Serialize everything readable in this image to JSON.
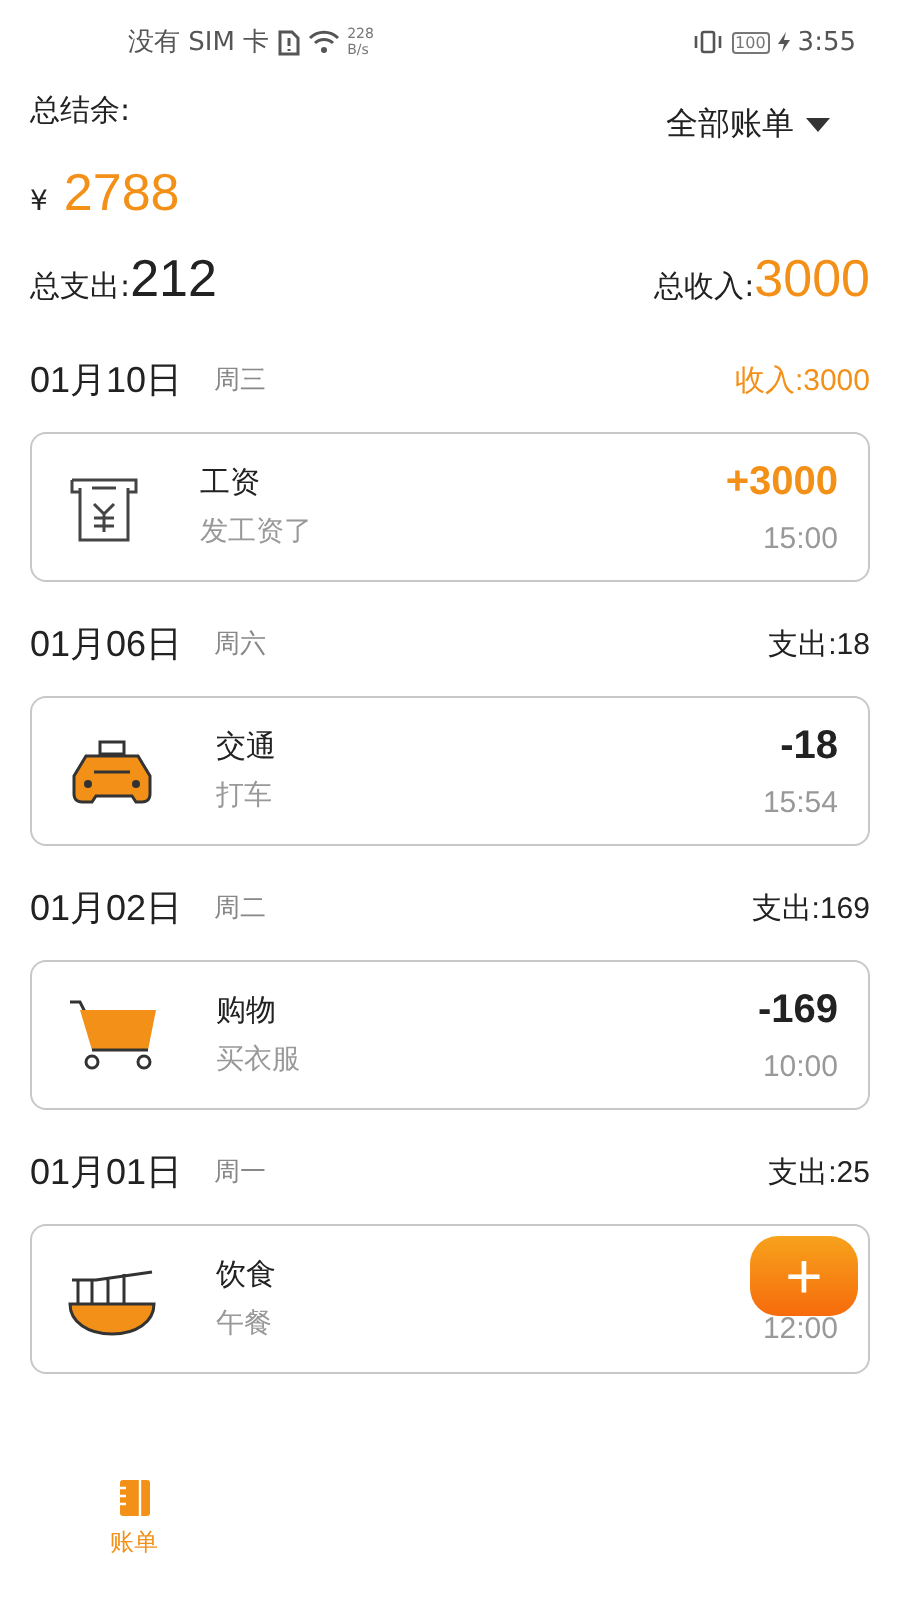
{
  "status_bar": {
    "carrier": "没有 SIM 卡",
    "speed_value": "228",
    "speed_unit": "B/s",
    "battery": "100",
    "time": "3:55"
  },
  "summary": {
    "balance_label": "总结余:",
    "filter": "全部账单",
    "currency": "¥",
    "balance": "2788",
    "expense_label": "总支出:",
    "expense": "212",
    "income_label": "总收入:",
    "income": "3000"
  },
  "days": [
    {
      "date": "01月10日",
      "weekday": "周三",
      "total_label": "收入:3000",
      "kind": "income",
      "entries": [
        {
          "kind": "salary",
          "category": "工资",
          "note": "发工资了",
          "amount": "+3000",
          "time": "15:00"
        }
      ]
    },
    {
      "date": "01月06日",
      "weekday": "周六",
      "total_label": "支出:18",
      "kind": "expense",
      "entries": [
        {
          "kind": "taxi",
          "category": "交通",
          "note": "打车",
          "amount": "-18",
          "time": "15:54"
        }
      ]
    },
    {
      "date": "01月02日",
      "weekday": "周二",
      "total_label": "支出:169",
      "kind": "expense",
      "entries": [
        {
          "kind": "cart",
          "category": "购物",
          "note": "买衣服",
          "amount": "-169",
          "time": "10:00"
        }
      ]
    },
    {
      "date": "01月01日",
      "weekday": "周一",
      "total_label": "支出:25",
      "kind": "expense",
      "entries": [
        {
          "kind": "bowl",
          "category": "饮食",
          "note": "午餐",
          "time": "12:00"
        }
      ]
    }
  ],
  "fab": {
    "label": "+"
  },
  "tabs": [
    {
      "label": "账单",
      "selected": true
    }
  ]
}
